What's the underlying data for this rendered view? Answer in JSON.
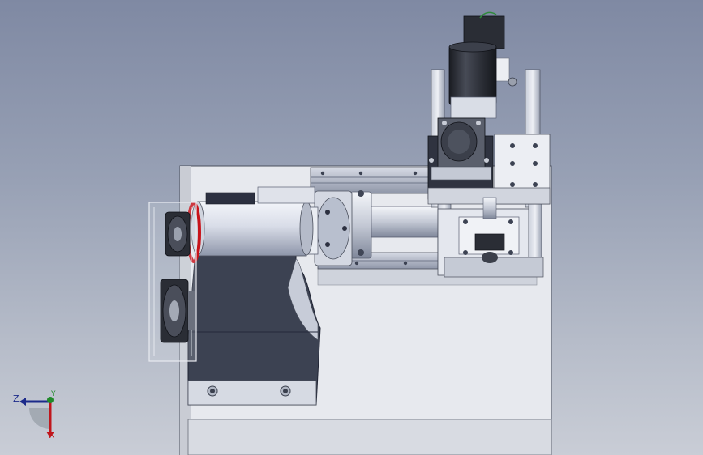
{
  "viewport": {
    "background_top": "#7f89a3",
    "background_bottom": "#c9cdd6"
  },
  "model": {
    "colors": {
      "base_gray": "#e6e8ec",
      "base_shadow": "#b9bec8",
      "dark_body": "#3c4252",
      "dark_body_edge": "#23283a",
      "rail_steel": "#b6bccb",
      "motor_black": "#2a2d35",
      "cylinder_light": "#dfe3ec",
      "belt_red": "#c8131a",
      "bolt_gray": "#8b909b"
    }
  },
  "triad": {
    "axis_z": {
      "label": "Z",
      "color": "#1b2a8a",
      "icon": "arrow-left-icon"
    },
    "axis_y": {
      "label": "Y",
      "color": "#208a2a",
      "icon": "arrow-up-icon"
    },
    "axis_x": {
      "label": "X",
      "color": "#c0161c",
      "icon": "arrow-down-icon"
    }
  }
}
